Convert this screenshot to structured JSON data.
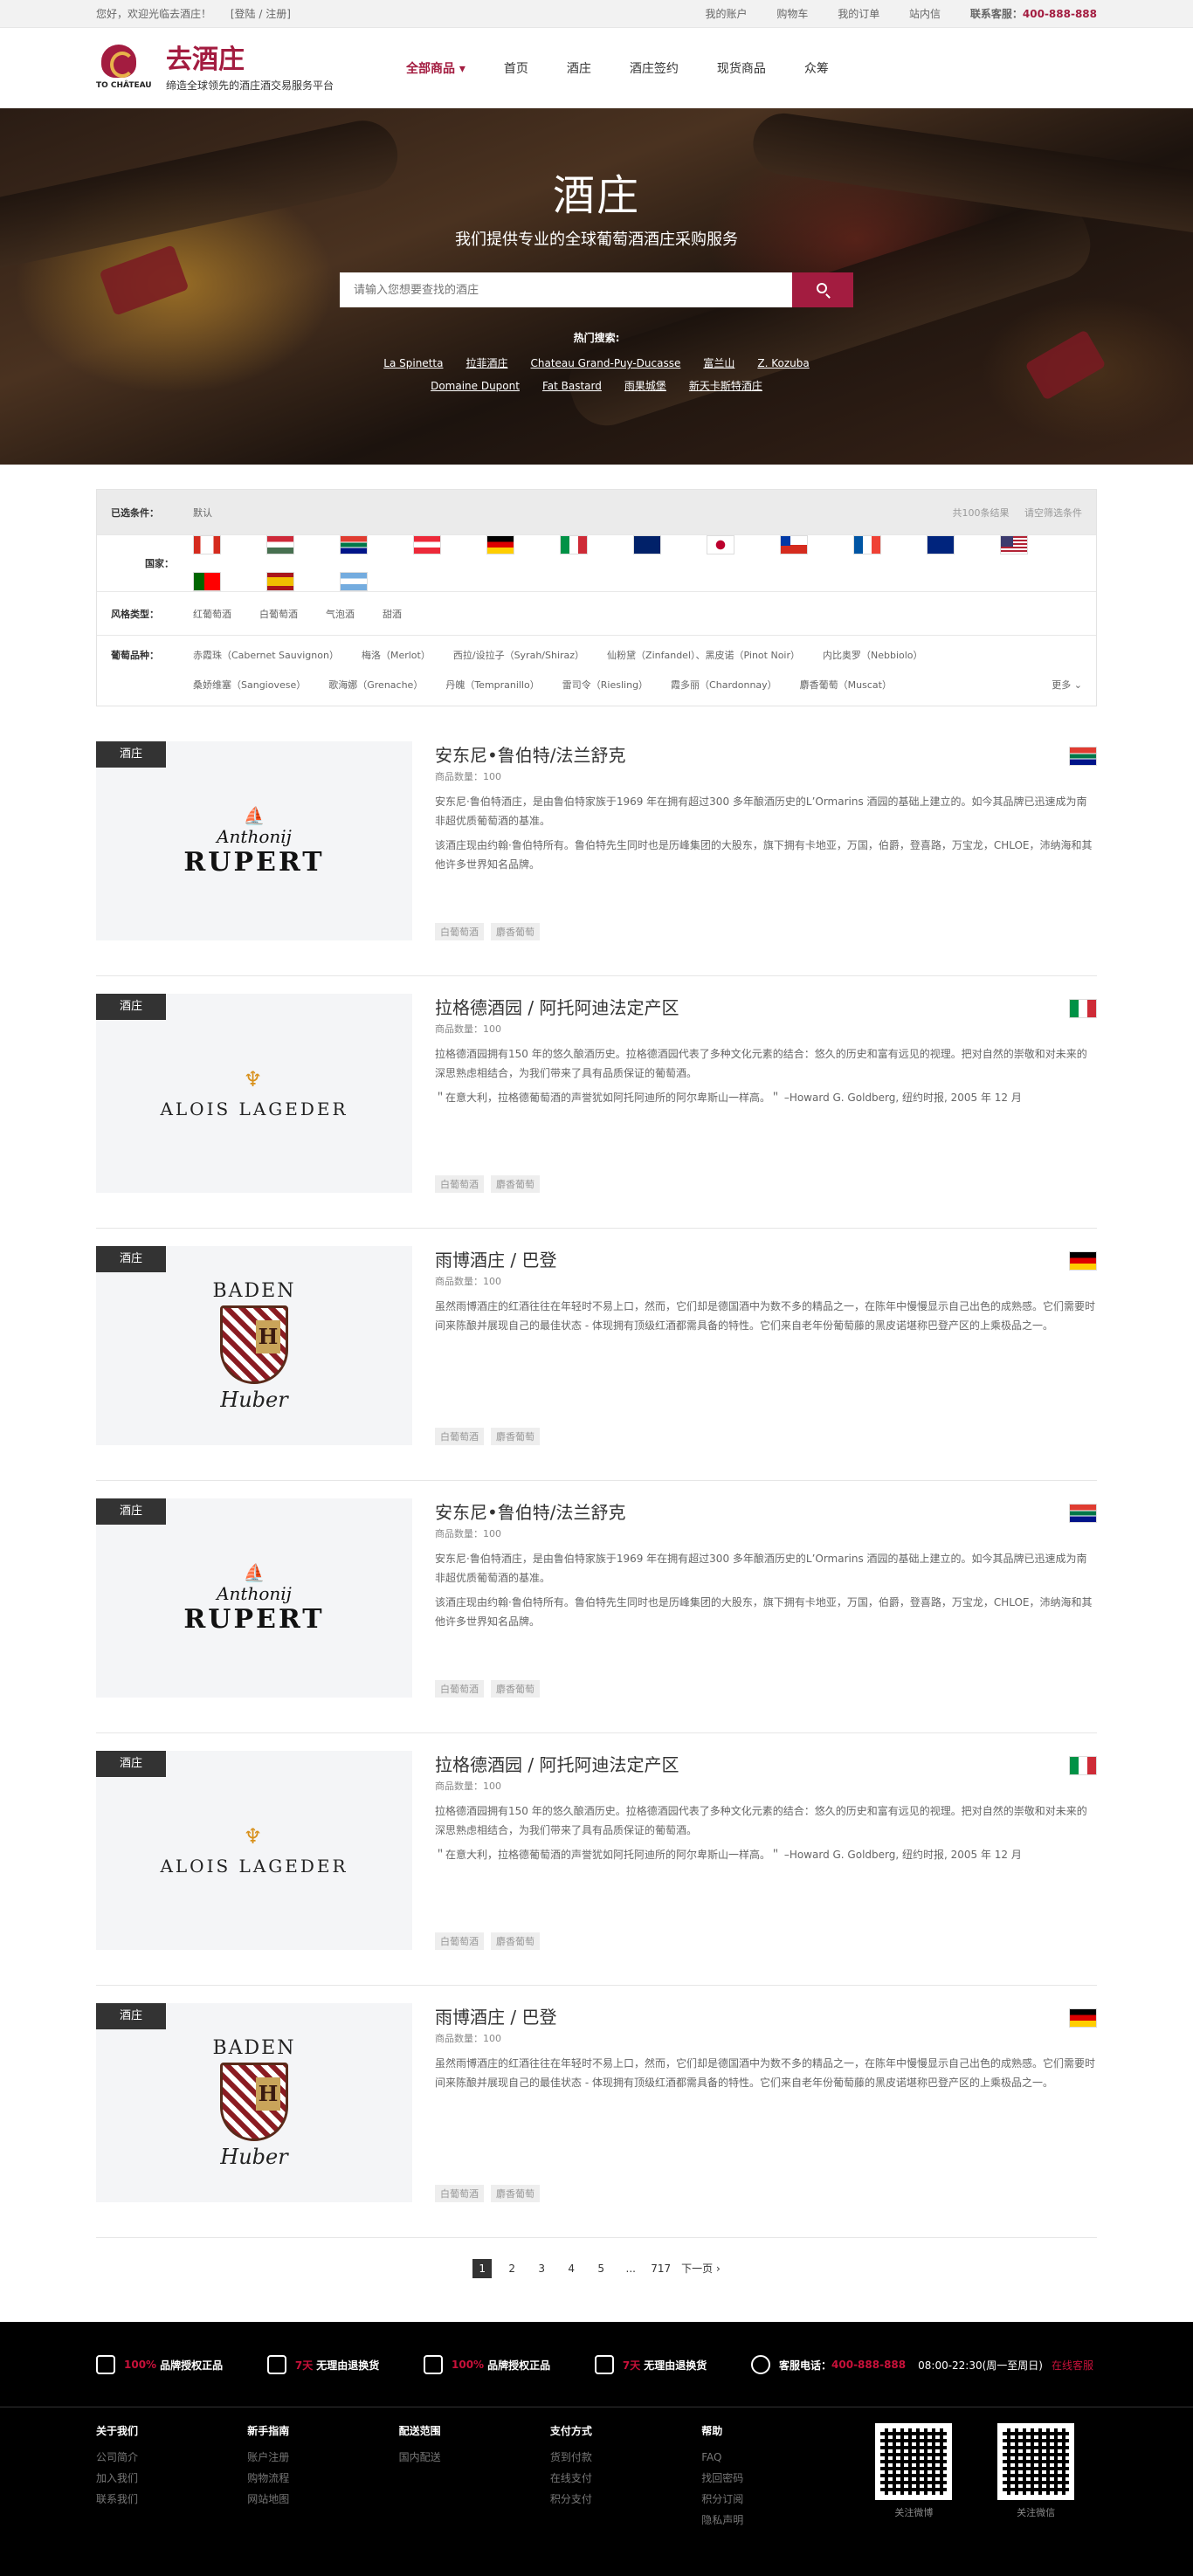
{
  "topbar": {
    "greeting": "您好，欢迎光临去酒庄！",
    "login": "[登陆 / 注册]",
    "links": [
      "我的账户",
      "购物车",
      "我的订单",
      "站内信"
    ],
    "service_label": "联系客服：",
    "service_phone": "400-888-888"
  },
  "header": {
    "logo_cn": "去酒庄",
    "logo_en": "TO CHÂTEAU",
    "logo_sub": "缔造全球领先的酒庄酒交易服务平台",
    "nav": [
      "全部商品 ▾",
      "首页",
      "酒庄",
      "酒庄签约",
      "现货商品",
      "众筹"
    ]
  },
  "banner": {
    "title": "酒庄",
    "slogan": "我们提供专业的全球葡萄酒酒庄采购服务",
    "search_placeholder": "请输入您想要查找的酒庄",
    "hot_title": "热门搜索:",
    "hot_links": [
      "La Spinetta",
      "拉菲酒庄",
      "Chateau Grand-Puy-Ducasse",
      "富兰山",
      "Z. Kozuba",
      "Domaine Dupont",
      "Fat Bastard",
      "雨果城堡",
      "新天卡斯特酒庄"
    ]
  },
  "filter": {
    "selected_label": "已选条件：",
    "selected_value": "默认",
    "result_count": "共100条结果",
    "clear": "请空筛选条件",
    "country_label": "国家：",
    "flags": [
      "canada-flag",
      "hungary-flag",
      "south-africa-flag",
      "austria-flag",
      "germany-flag",
      "italy-flag",
      "new-zealand-flag",
      "japan-flag",
      "chile-flag",
      "france-flag",
      "australia-flag",
      "usa-flag",
      "portugal-flag",
      "spain-flag",
      "argentina-flag"
    ],
    "style_label": "风格类型：",
    "styles": [
      "红葡萄酒",
      "白葡萄酒",
      "气泡酒",
      "甜酒"
    ],
    "grape_label": "葡萄品种：",
    "grapes": [
      "赤霞珠（Cabernet Sauvignon）",
      "梅洛（Merlot）",
      "西拉/设拉子（Syrah/Shiraz）",
      "仙粉黛（Zinfandel）、黑皮诺（Pinot Noir）",
      "内比奥罗（Nebbiolo）",
      "桑娇维塞（Sangiovese）",
      "歌海娜（Grenache）",
      "丹魄（Tempranillo）",
      "雷司令（Riesling）",
      "霞多丽（Chardonnay）",
      "麝香葡萄（Muscat）"
    ],
    "more": "更多"
  },
  "items": [
    {
      "tag": "酒庄",
      "name": "安东尼•鲁伯特/法兰舒克",
      "count": "商品数量：100",
      "logo": "rupert",
      "flag": "south-africa-flag",
      "desc": [
        "安东尼·鲁伯特酒庄，是由鲁伯特家族于1969 年在拥有超过300 多年酿酒历史的L’Ormarins 酒园的基础上建立的。如今其品牌已迅速成为南非超优质葡萄酒的基准。",
        "该酒庄现由约翰·鲁伯特所有。鲁伯特先生同时也是历峰集团的大股东，旗下拥有卡地亚，万国，伯爵，登喜路，万宝龙，CHLOE，沛纳海和其他许多世界知名品牌。"
      ],
      "tags": [
        "白葡萄酒",
        "麝香葡萄"
      ]
    },
    {
      "tag": "酒庄",
      "name": "拉格德酒园 / 阿托阿迪法定产区",
      "count": "商品数量：100",
      "logo": "alois",
      "flag": "italy-flag",
      "desc": [
        "拉格德酒园拥有150 年的悠久酿酒历史。拉格德酒园代表了多种文化元素的结合：悠久的历史和富有远见的视理。把对自然的崇敬和对未来的深思熟虑相结合，为我们带来了具有品质保证的葡萄酒。",
        "＂在意大利，拉格德葡萄酒的声誉犹如阿托阿迪所的阿尔卑斯山一样高。＂ –Howard G. Goldberg, 纽约时报, 2005 年 12 月"
      ],
      "tags": [
        "白葡萄酒",
        "麝香葡萄"
      ]
    },
    {
      "tag": "酒庄",
      "name": "雨博酒庄 / 巴登",
      "count": "商品数量：100",
      "logo": "baden",
      "flag": "germany-flag",
      "desc": [
        "虽然雨博酒庄的红酒往往在年轻时不易上口，然而，它们却是德国酒中为数不多的精品之一，在陈年中慢慢显示自己出色的成熟感。它们需要时间来陈酿并展现自己的最佳状态 - 体现拥有顶级红酒都需具备的特性。它们来自老年份葡萄藤的黑皮诺堪称巴登产区的上乘极品之一。"
      ],
      "tags": [
        "白葡萄酒",
        "麝香葡萄"
      ]
    },
    {
      "tag": "酒庄",
      "name": "安东尼•鲁伯特/法兰舒克",
      "count": "商品数量：100",
      "logo": "rupert",
      "flag": "south-africa-flag",
      "desc": [
        "安东尼·鲁伯特酒庄，是由鲁伯特家族于1969 年在拥有超过300 多年酿酒历史的L’Ormarins 酒园的基础上建立的。如今其品牌已迅速成为南非超优质葡萄酒的基准。",
        "该酒庄现由约翰·鲁伯特所有。鲁伯特先生同时也是历峰集团的大股东，旗下拥有卡地亚，万国，伯爵，登喜路，万宝龙，CHLOE，沛纳海和其他许多世界知名品牌。"
      ],
      "tags": [
        "白葡萄酒",
        "麝香葡萄"
      ]
    },
    {
      "tag": "酒庄",
      "name": "拉格德酒园 / 阿托阿迪法定产区",
      "count": "商品数量：100",
      "logo": "alois",
      "flag": "italy-flag",
      "desc": [
        "拉格德酒园拥有150 年的悠久酿酒历史。拉格德酒园代表了多种文化元素的结合：悠久的历史和富有远见的视理。把对自然的崇敬和对未来的深思熟虑相结合，为我们带来了具有品质保证的葡萄酒。",
        "＂在意大利，拉格德葡萄酒的声誉犹如阿托阿迪所的阿尔卑斯山一样高。＂ –Howard G. Goldberg, 纽约时报, 2005 年 12 月"
      ],
      "tags": [
        "白葡萄酒",
        "麝香葡萄"
      ]
    },
    {
      "tag": "酒庄",
      "name": "雨博酒庄 / 巴登",
      "count": "商品数量：100",
      "logo": "baden",
      "flag": "germany-flag",
      "desc": [
        "虽然雨博酒庄的红酒往往在年轻时不易上口，然而，它们却是德国酒中为数不多的精品之一，在陈年中慢慢显示自己出色的成熟感。它们需要时间来陈酿并展现自己的最佳状态 - 体现拥有顶级红酒都需具备的特性。它们来自老年份葡萄藤的黑皮诺堪称巴登产区的上乘极品之一。"
      ],
      "tags": [
        "白葡萄酒",
        "麝香葡萄"
      ]
    }
  ],
  "logos": {
    "rupert_script": "Anthonij",
    "rupert_name": "RUPERT",
    "alois": "ALOIS LAGEDER",
    "baden_title": "BADEN",
    "baden_sig": "Huber"
  },
  "pager": {
    "pages": [
      "1",
      "2",
      "3",
      "4",
      "5",
      "...",
      "717"
    ],
    "current": "1",
    "next": "下一页 ›"
  },
  "footer": {
    "promises": [
      {
        "icon": "shield-icon",
        "red": "100%",
        "text": "品牌授权正品"
      },
      {
        "icon": "truck-icon",
        "red": "7天",
        "text": "无理由退换货"
      },
      {
        "icon": "shield-icon",
        "red": "100%",
        "text": "品牌授权正品"
      },
      {
        "icon": "truck-icon",
        "red": "7天",
        "text": "无理由退换货"
      }
    ],
    "hotline_label": "客服电话：",
    "hotline": "400-888-888",
    "hours": "08:00-22:30(周一至周日)",
    "online": "在线客服",
    "columns": [
      {
        "title": "关于我们",
        "links": [
          "公司简介",
          "加入我们",
          "联系我们"
        ]
      },
      {
        "title": "新手指南",
        "links": [
          "账户注册",
          "购物流程",
          "网站地图"
        ]
      },
      {
        "title": "配送范围",
        "links": [
          "国内配送"
        ]
      },
      {
        "title": "支付方式",
        "links": [
          "货到付款",
          "在线支付",
          "积分支付"
        ]
      },
      {
        "title": "帮助",
        "links": [
          "FAQ",
          "找回密码",
          "积分订阅",
          "隐私声明"
        ]
      }
    ],
    "qr": [
      "关注微博",
      "关注微信"
    ]
  },
  "colors": {
    "accent": "#a31c40",
    "dark": "#333333",
    "footer": "#000000"
  }
}
